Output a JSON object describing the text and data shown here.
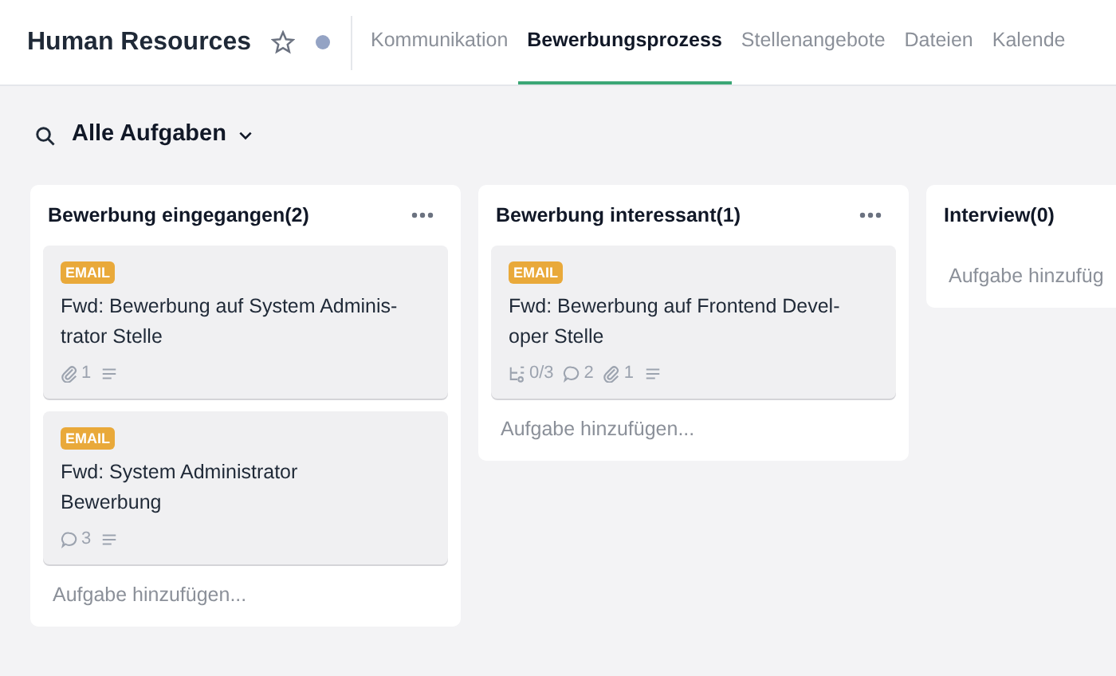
{
  "header": {
    "title": "Human Resources",
    "favorite": false
  },
  "tabs": [
    {
      "label": "Kommunikation",
      "selected": false
    },
    {
      "label": "Bewerbungsprozess",
      "selected": true
    },
    {
      "label": "Stellenangebote",
      "selected": false
    },
    {
      "label": "Dateien",
      "selected": false
    },
    {
      "label": "Kalende",
      "selected": false
    }
  ],
  "filter": {
    "label": "Alle Aufgaben"
  },
  "columns": [
    {
      "title": "Bewerbung eingegangen(2)",
      "add_label": "Aufgabe hinzufügen...",
      "cards": [
        {
          "tag": "EMAIL",
          "title": "Fwd: Bewerbung auf System Adminis-\ntrator Stelle",
          "meta": [
            {
              "kind": "attachments",
              "text": "1"
            },
            {
              "kind": "description"
            }
          ]
        },
        {
          "tag": "EMAIL",
          "title": "Fwd: System Administrator\nBewerbung",
          "meta": [
            {
              "kind": "comments",
              "text": "3"
            },
            {
              "kind": "description"
            }
          ]
        }
      ]
    },
    {
      "title": "Bewerbung interessant(1)",
      "add_label": "Aufgabe hinzufügen...",
      "cards": [
        {
          "tag": "EMAIL",
          "title": "Fwd: Bewerbung auf Frontend Devel-\noper Stelle",
          "meta": [
            {
              "kind": "subtasks",
              "text": "0/3"
            },
            {
              "kind": "comments",
              "text": "2"
            },
            {
              "kind": "attachments",
              "text": "1"
            },
            {
              "kind": "description"
            }
          ]
        }
      ]
    },
    {
      "title": "Interview(0)",
      "add_label": "Aufgabe hinzufüg"
    }
  ]
}
